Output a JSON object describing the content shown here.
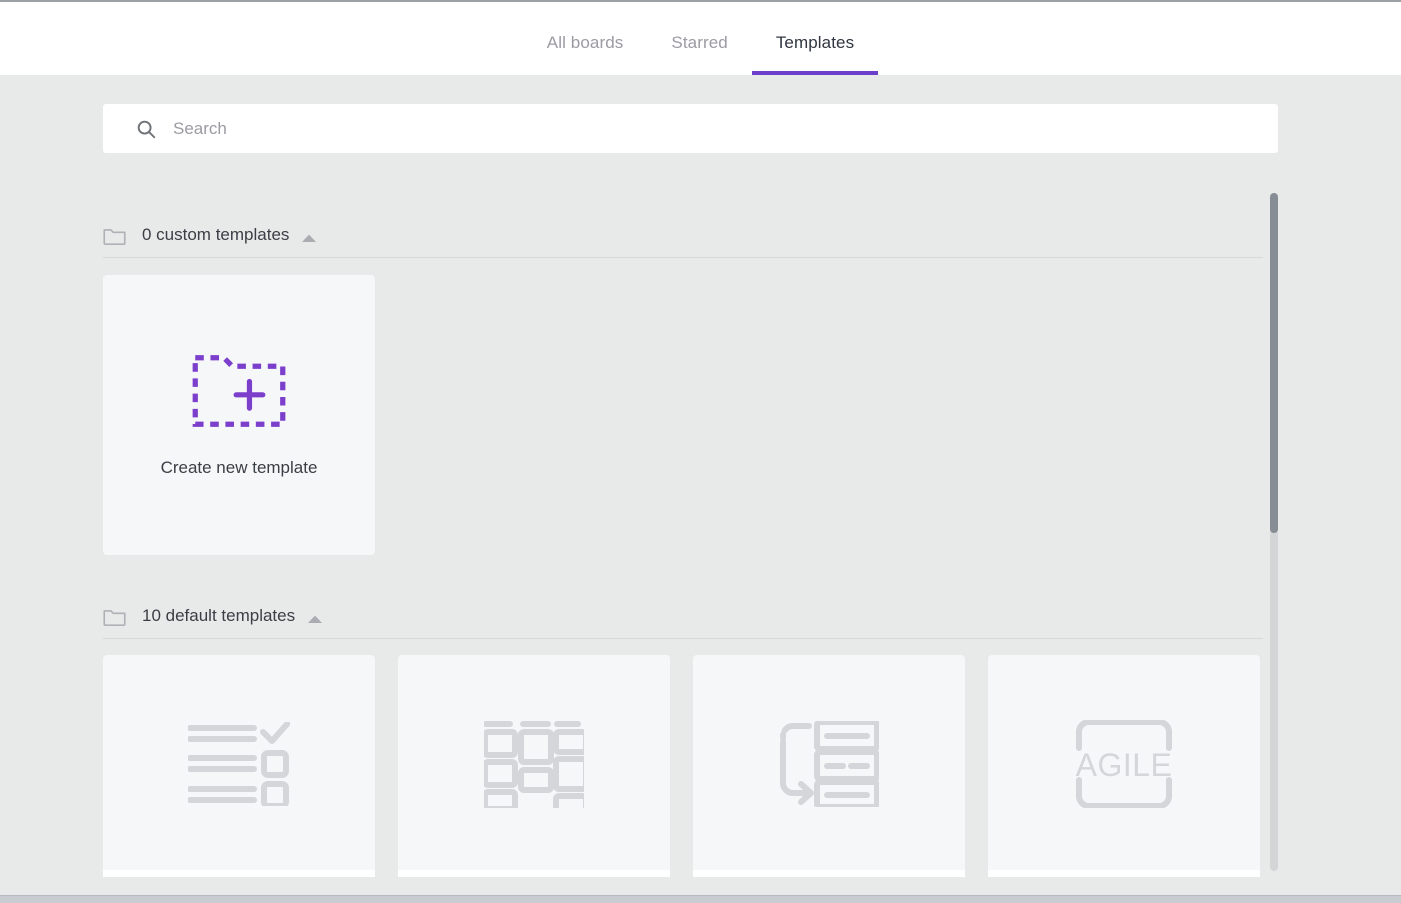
{
  "header": {
    "tabs": [
      {
        "label": "All boards",
        "active": false,
        "name": "tab-all-boards"
      },
      {
        "label": "Starred",
        "active": false,
        "name": "tab-starred"
      },
      {
        "label": "Templates",
        "active": true,
        "name": "tab-templates"
      }
    ],
    "active_tab": "Templates",
    "accent_color": "#6b3fc9"
  },
  "search": {
    "placeholder": "Search",
    "value": "",
    "icon": "search-icon"
  },
  "sections": [
    {
      "title": "0 custom templates",
      "count": 0,
      "kind": "custom",
      "folder_icon": "folder-icon",
      "toggle_icon": "chevron-up-icon",
      "expanded": true
    },
    {
      "title": "10 default templates",
      "count": 10,
      "kind": "default",
      "folder_icon": "folder-icon",
      "toggle_icon": "chevron-up-icon",
      "expanded": true
    }
  ],
  "create_card": {
    "label": "Create new template",
    "icon": "folder-plus-dashed-icon",
    "icon_color": "#7B3FCC"
  },
  "default_templates": [
    {
      "thumb_icon": "checklist-icon",
      "name": "template-card-checklist"
    },
    {
      "thumb_icon": "kanban-board-icon",
      "name": "template-card-kanban"
    },
    {
      "thumb_icon": "workflow-rows-icon",
      "name": "template-card-workflow"
    },
    {
      "thumb_icon": "agile-text-icon",
      "label": "AGILE",
      "name": "template-card-agile"
    }
  ],
  "scrollbar": {
    "orientation": "vertical",
    "thumb_position_pct": 0,
    "thumb_size_pct": 50
  },
  "colors": {
    "page_background": "#e8e9e9",
    "card_background": "#f6f7f9",
    "accent_purple": "#6b3fc9",
    "text_primary": "#3a3f45",
    "text_muted": "#9b9ba3"
  }
}
